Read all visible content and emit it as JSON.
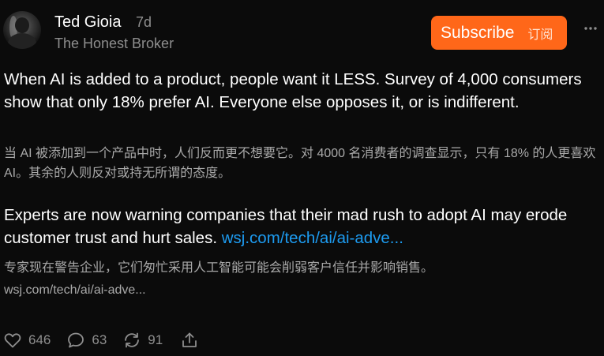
{
  "post": {
    "author": "Ted Gioia",
    "time_ago": "7d",
    "publication": "The Honest Broker",
    "subscribe_label": "Subscribe",
    "subscribe_translation": "订阅",
    "text_1": "When AI is added to a product, people want it LESS. Survey of 4,000 consumers show that only 18% prefer AI. Everyone else opposes it, or is indifferent.",
    "translation_1": "当 AI 被添加到一个产品中时，人们反而更不想要它。对 4000 名消费者的调查显示，只有 18% 的人更喜欢 AI。其余的人则反对或持无所谓的态度。",
    "text_2": "Experts are now warning companies that their mad rush to adopt AI may erode customer trust and hurt sales.",
    "link": "wsj.com/tech/ai/ai-adve...",
    "translation_2": "专家现在警告企业，它们匆忙采用人工智能可能会削弱客户信任并影响销售。",
    "translation_link": "wsj.com/tech/ai/ai-adve..."
  },
  "actions": {
    "likes": "646",
    "comments": "63",
    "restacks": "91"
  },
  "icons": {
    "more": "more-horizontal-icon",
    "like": "heart-icon",
    "comment": "comment-bubble-icon",
    "restack": "restack-arrows-icon",
    "share": "share-upload-icon"
  },
  "colors": {
    "background": "#0b0b0b",
    "accent": "#ff6719",
    "link": "#1d9bf0",
    "muted": "#8e8e8e"
  }
}
